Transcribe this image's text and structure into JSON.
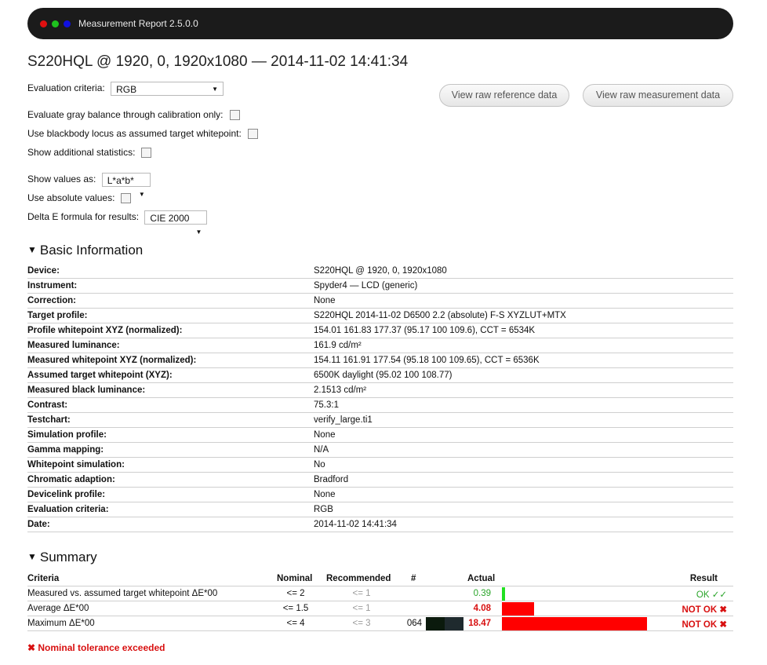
{
  "window": {
    "title": "Measurement Report 2.5.0.0",
    "controls": [
      {
        "name": "close-dot",
        "color": "#e01010"
      },
      {
        "name": "minimize-dot",
        "color": "#1ec21e"
      },
      {
        "name": "maximize-dot",
        "color": "#1010e0"
      }
    ]
  },
  "heading": "S220HQL @ 1920, 0, 1920x1080 — 2014-11-02 14:41:34",
  "options": {
    "eval_criteria_label": "Evaluation criteria:",
    "eval_criteria_value": "RGB",
    "gray_balance_label": "Evaluate gray balance through calibration only:",
    "blackbody_label": "Use blackbody locus as assumed target whitepoint:",
    "additional_stats_label": "Show additional statistics:",
    "show_values_label": "Show values as:",
    "show_values_value": "L*a*b*",
    "absolute_label": "Use absolute values:",
    "delta_e_label": "Delta E formula for results:",
    "delta_e_value": "CIE 2000"
  },
  "buttons": {
    "raw_reference": "View raw reference data",
    "raw_measurement": "View raw measurement data"
  },
  "basic_info": {
    "title": "Basic Information",
    "rows": [
      {
        "k": "Device:",
        "v": "S220HQL @ 1920, 0, 1920x1080"
      },
      {
        "k": "Instrument:",
        "v": "Spyder4 — LCD (generic)"
      },
      {
        "k": "Correction:",
        "v": "None"
      },
      {
        "k": "Target profile:",
        "v": "S220HQL 2014-11-02 D6500 2.2 (absolute) F-S XYZLUT+MTX"
      },
      {
        "k": "Profile whitepoint XYZ (normalized):",
        "v": "154.01 161.83 177.37 (95.17 100 109.6), CCT = 6534K"
      },
      {
        "k": "Measured luminance:",
        "v": "161.9 cd/m²"
      },
      {
        "k": "Measured whitepoint XYZ (normalized):",
        "v": "154.11 161.91 177.54 (95.18 100 109.65), CCT = 6536K"
      },
      {
        "k": "Assumed target whitepoint (XYZ):",
        "v": "6500K daylight (95.02 100 108.77)"
      },
      {
        "k": "Measured black luminance:",
        "v": "2.1513 cd/m²"
      },
      {
        "k": "Contrast:",
        "v": "75.3:1"
      },
      {
        "k": "Testchart:",
        "v": "verify_large.ti1"
      },
      {
        "k": "Simulation profile:",
        "v": "None"
      },
      {
        "k": "Gamma mapping:",
        "v": "N/A"
      },
      {
        "k": "Whitepoint simulation:",
        "v": "No"
      },
      {
        "k": "Chromatic adaption:",
        "v": "Bradford"
      },
      {
        "k": "Devicelink profile:",
        "v": "None"
      },
      {
        "k": "Evaluation criteria:",
        "v": "RGB"
      },
      {
        "k": "Date:",
        "v": "2014-11-02 14:41:34"
      }
    ]
  },
  "summary": {
    "title": "Summary",
    "headers": {
      "criteria": "Criteria",
      "nominal": "Nominal",
      "recommended": "Recommended",
      "num": "#",
      "actual": "Actual",
      "result": "Result"
    },
    "rows": [
      {
        "criteria": "Measured vs. assumed target whitepoint ΔE*00",
        "nominal": "<= 2",
        "recommended": "<= 1",
        "num": "",
        "actual": "0.39",
        "actual_value": 0.39,
        "result": "OK ✓✓",
        "status": "ok",
        "bar_color": "#22e022"
      },
      {
        "criteria": "Average ΔE*00",
        "nominal": "<= 1.5",
        "recommended": "<= 1",
        "num": "",
        "actual": "4.08",
        "actual_value": 4.08,
        "result": "NOT OK ✖",
        "status": "fail",
        "bar_color": "#ff0000"
      },
      {
        "criteria": "Maximum ΔE*00",
        "nominal": "<= 4",
        "recommended": "<= 3",
        "num": "064",
        "actual": "18.47",
        "actual_value": 18.47,
        "result": "NOT OK ✖",
        "status": "fail",
        "bar_color": "#ff0000",
        "swatches": [
          "#0b1a0d",
          "#1f2a2e"
        ]
      }
    ],
    "footer": "✖ Nominal tolerance exceeded"
  },
  "colors": {
    "ok": "#2aa52a",
    "fail": "#d81010",
    "panel": "#1b1b1b"
  }
}
